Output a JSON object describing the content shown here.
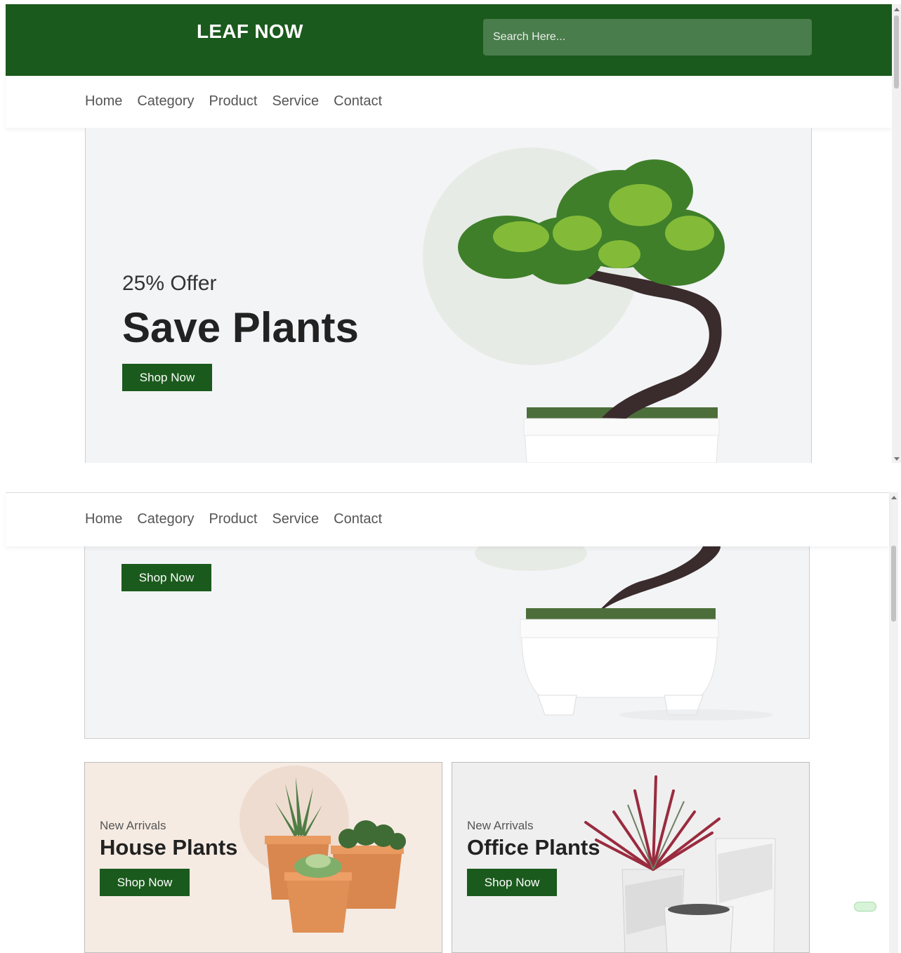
{
  "header": {
    "logo": "LEAF NOW",
    "search_placeholder": "Search Here..."
  },
  "nav": {
    "items": [
      "Home",
      "Category",
      "Product",
      "Service",
      "Contact"
    ]
  },
  "hero": {
    "offer": "25% Offer",
    "title": "Save Plants",
    "button": "Shop Now"
  },
  "cards": [
    {
      "subtitle": "New Arrivals",
      "title": "House Plants",
      "button": "Shop Now"
    },
    {
      "subtitle": "New Arrivals",
      "title": "Office Plants",
      "button": "Shop Now"
    }
  ],
  "colors": {
    "brand_green": "#1b5a1d",
    "search_bg": "#4a7d4c",
    "hero_bg": "#f3f4f6"
  }
}
